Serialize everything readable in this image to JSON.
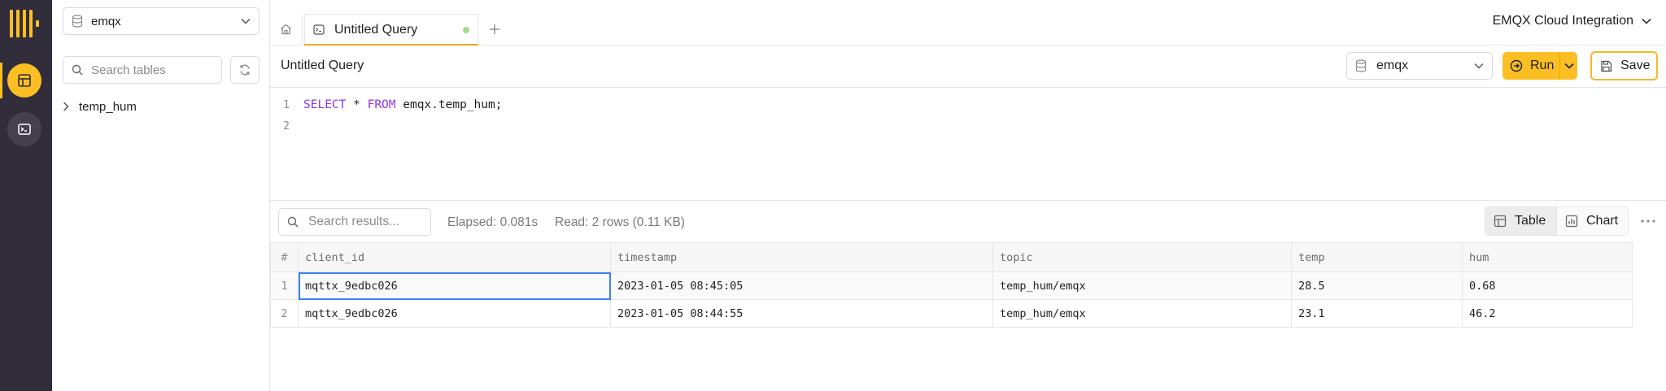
{
  "sidebar": {
    "database": "emqx",
    "search_placeholder": "Search tables",
    "tables": [
      {
        "name": "temp_hum"
      }
    ]
  },
  "tabs": {
    "active": {
      "label": "Untitled Query"
    }
  },
  "workspace": {
    "label": "EMQX Cloud Integration"
  },
  "toolbar": {
    "title": "Untitled Query",
    "database": "emqx",
    "run_label": "Run",
    "save_label": "Save"
  },
  "editor": {
    "line_numbers": [
      "1",
      "2"
    ],
    "sql": {
      "kw_select": "SELECT",
      "star": " * ",
      "kw_from": "FROM",
      "rest": " emqx.temp_hum;"
    }
  },
  "results": {
    "search_placeholder": "Search results...",
    "elapsed": "Elapsed: 0.081s",
    "read": "Read: 2 rows (0.11 KB)",
    "view_table": "Table",
    "view_chart": "Chart",
    "columns": [
      "#",
      "client_id",
      "timestamp",
      "topic",
      "temp",
      "hum"
    ],
    "rows": [
      {
        "n": "1",
        "client_id": "mqttx_9edbc026",
        "timestamp": "2023-01-05 08:45:05",
        "topic": "temp_hum/emqx",
        "temp": "28.5",
        "hum": "0.68"
      },
      {
        "n": "2",
        "client_id": "mqttx_9edbc026",
        "timestamp": "2023-01-05 08:44:55",
        "topic": "temp_hum/emqx",
        "temp": "23.1",
        "hum": "46.2"
      }
    ]
  },
  "colors": {
    "rail_bg": "#312d3b",
    "accent": "#fbbf24",
    "keyword": "#9333ea",
    "selection": "#3b82f6"
  },
  "icons": [
    "logo",
    "table-icon",
    "terminal-icon",
    "database-icon",
    "search-icon",
    "refresh-icon",
    "chevron-right-icon",
    "chevron-down-icon",
    "home-icon",
    "query-tab-icon",
    "plus-icon",
    "run-icon",
    "save-icon",
    "chart-icon",
    "more-icon"
  ]
}
